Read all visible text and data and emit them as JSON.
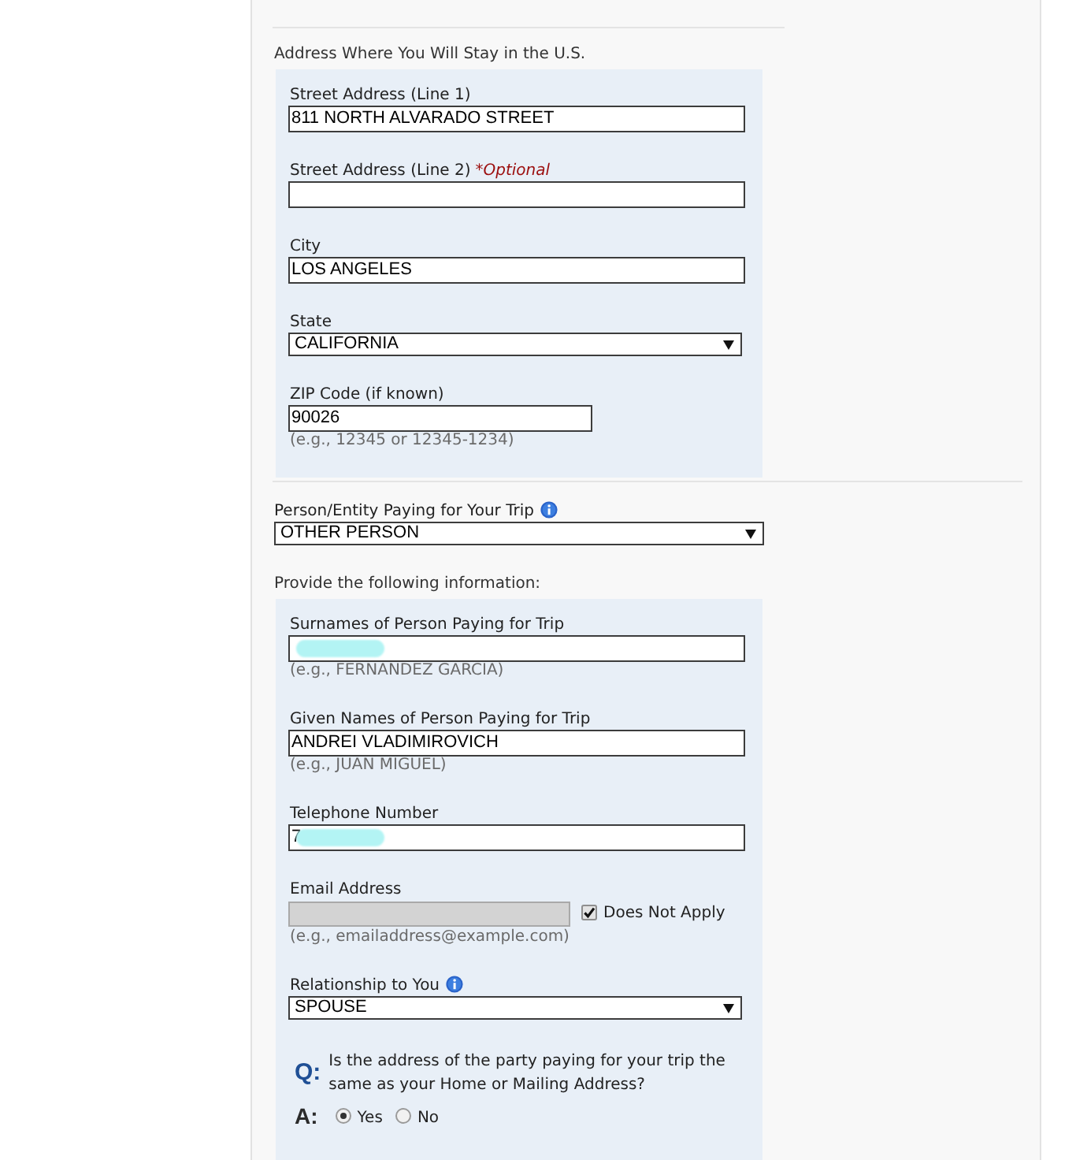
{
  "top_section": {
    "heading": "Address Where You Will Stay in the U.S.",
    "fields": [
      {
        "kind": "text",
        "label": "Street Address (Line 1)",
        "value": "811 NORTH ALVARADO STREET"
      },
      {
        "kind": "text",
        "label": "Street Address (Line 2)",
        "note": "*Optional"
      },
      {
        "kind": "text",
        "label": "City",
        "value": "LOS ANGELES"
      },
      {
        "kind": "select",
        "label": "State",
        "value": "CALIFORNIA"
      },
      {
        "kind": "short_text",
        "label": "ZIP Code (if known)",
        "value": "90026",
        "hint": "(e.g., 12345 or 12345-1234)"
      }
    ]
  },
  "payer": {
    "label": "Person/Entity Paying for Your Trip",
    "info": true,
    "value": "OTHER PERSON"
  },
  "payer_details": {
    "heading": "Provide the following information:",
    "fields": [
      {
        "kind": "text",
        "label": "Surnames of Person Paying for Trip",
        "redacted": true,
        "hint": "(e.g., FERNANDEZ GARCIA)"
      },
      {
        "kind": "text",
        "label": "Given Names of Person Paying for Trip",
        "value": "ANDREI VLADIMIROVICH",
        "hint": "(e.g., JUAN MIGUEL)"
      },
      {
        "kind": "text",
        "label": "Telephone Number",
        "value": "7",
        "redacted": true
      },
      {
        "kind": "email",
        "label": "Email Address",
        "disabled": true,
        "hint": "(e.g., emailaddress@example.com)",
        "does_not_apply": {
          "label": "Does Not Apply",
          "checked": true
        }
      },
      {
        "kind": "select",
        "label": "Relationship to You",
        "info": true,
        "value": "SPOUSE"
      }
    ],
    "question": {
      "q_mark": "Q:",
      "text": "Is the address of the party paying for your trip the same as your Home or Mailing Address?",
      "a_mark": "A:",
      "options": [
        {
          "label": "Yes",
          "selected": true
        },
        {
          "label": "No",
          "selected": false
        }
      ]
    }
  }
}
